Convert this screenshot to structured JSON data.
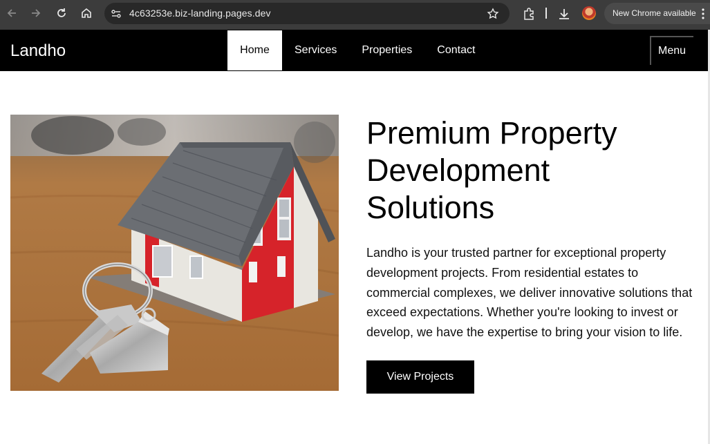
{
  "browser": {
    "url": "4c63253e.biz-landing.pages.dev",
    "update_label": "New Chrome available"
  },
  "site": {
    "brand": "Landho",
    "nav": [
      {
        "label": "Home",
        "active": true
      },
      {
        "label": "Services",
        "active": false
      },
      {
        "label": "Properties",
        "active": false
      },
      {
        "label": "Contact",
        "active": false
      }
    ],
    "menu_label": "Menu"
  },
  "hero": {
    "title_line1": "Premium Property",
    "title_line2": "Development",
    "title_line3": "Solutions",
    "description": "Landho is your trusted partner for exceptional property development projects. From residential estates to commercial complexes, we deliver innovative solutions that exceed expectations. Whether you're looking to invest or develop, we have the expertise to bring your vision to life.",
    "cta_label": "View Projects"
  },
  "colors": {
    "nav_bg": "#000000",
    "chrome_bg": "#3c3c3c",
    "house_red": "#d6232a",
    "roof": "#6b6e73"
  }
}
